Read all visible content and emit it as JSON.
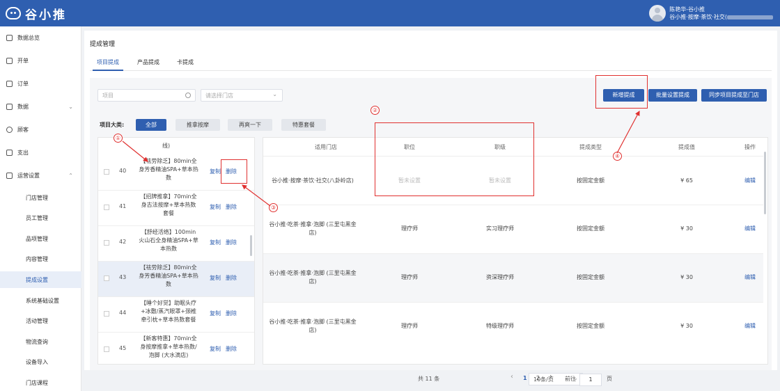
{
  "header": {
    "logo_text": "谷小推",
    "user_line1": "陈艳华-谷小推",
    "user_line2": "谷小推·按摩·茶饮·社交("
  },
  "sidebar": {
    "items": [
      {
        "label": "数据总览",
        "icon": "dashboard-icon"
      },
      {
        "label": "开单",
        "icon": "order-form-icon"
      },
      {
        "label": "订单",
        "icon": "orders-icon"
      },
      {
        "label": "数据",
        "icon": "data-icon",
        "chevron": "⌄"
      },
      {
        "label": "顾客",
        "icon": "customer-icon"
      },
      {
        "label": "支出",
        "icon": "expense-icon"
      },
      {
        "label": "运营设置",
        "icon": "operations-icon",
        "chevron": "⌃"
      }
    ],
    "sub_items": [
      "门店管理",
      "员工管理",
      "品项管理",
      "内容管理",
      "提成设置",
      "系统基础设置",
      "活动管理",
      "物流查询",
      "设备导入",
      "门店课程"
    ]
  },
  "page": {
    "title": "提成管理",
    "tabs": [
      "项目提成",
      "产品提成",
      "卡提成"
    ]
  },
  "filters": {
    "item_placeholder": "项目",
    "store_placeholder": "请选择门店"
  },
  "buttons": {
    "add": "新增提成",
    "batch": "批量设置提成",
    "sync": "同步项目提成至门店"
  },
  "category": {
    "label": "项目大类:",
    "options": [
      "全部",
      "推拿按摩",
      "再爽一下",
      "特惠套餐"
    ]
  },
  "left_list": {
    "top_fragment": "线)",
    "rows": [
      {
        "idx": "40",
        "name": "【祛劳除乏】80min全身芳香精油SPA+草本热数",
        "copy": "复制",
        "del": "删除"
      },
      {
        "idx": "41",
        "name": "【招牌推拿】70min全身古法按摩+草本热数套餐",
        "copy": "复制",
        "del": "删除"
      },
      {
        "idx": "42",
        "name": "【舒经活络】100min火山石全身精油SPA+草本热数",
        "copy": "复制",
        "del": "删除"
      },
      {
        "idx": "43",
        "name": "【祛劳除乏】80min全身芳香精油SPA+草本热数",
        "copy": "复制",
        "del": "删除"
      },
      {
        "idx": "44",
        "name": "【睡个好觉】助眠头疗+冰敷/蒸汽眼罩+颈椎牵引枕+草本热数套餐",
        "copy": "复制",
        "del": "删除"
      },
      {
        "idx": "45",
        "name": "【新客特惠】70min全身按摩推拿+草本热数/泡脚 (大水滴店)",
        "copy": "复制",
        "del": "删除"
      }
    ]
  },
  "table": {
    "columns": [
      "适用门店",
      "职位",
      "职级",
      "提成类型",
      "提成值",
      "操作"
    ],
    "rows": [
      {
        "store": "谷小推·按摩·茶饮·社交(八卦岭店)",
        "position": "暂未设置",
        "level": "暂未设置",
        "type": "按固定金额",
        "value": "¥ 65",
        "action": "编辑"
      },
      {
        "store": "谷小推·吃茶·推拿·泡脚 (三里屯黑金店)",
        "position": "理疗师",
        "level": "实习理疗师",
        "type": "按固定金额",
        "value": "¥ 30",
        "action": "编辑"
      },
      {
        "store": "谷小推·吃茶·推拿·泡脚 (三里屯黑金店)",
        "position": "理疗师",
        "level": "资深理疗师",
        "type": "按固定金额",
        "value": "¥ 30",
        "action": "编辑"
      },
      {
        "store": "谷小推·吃茶·推拿·泡脚 (三里屯黑金店)",
        "position": "理疗师",
        "level": "特级理疗师",
        "type": "按固定金额",
        "value": "¥ 30",
        "action": "编辑"
      }
    ]
  },
  "pagination": {
    "total": "共 11 条",
    "page_size": "10条/页",
    "prev": "‹",
    "pages": [
      "1",
      "2"
    ],
    "next": "›",
    "goto_label": "前往",
    "goto_value": "1",
    "page_suffix": "页"
  },
  "annotations": [
    "①",
    "②",
    "③",
    "④"
  ],
  "colors": {
    "accent": "#2f5fb0",
    "annotation": "#e0302f"
  }
}
